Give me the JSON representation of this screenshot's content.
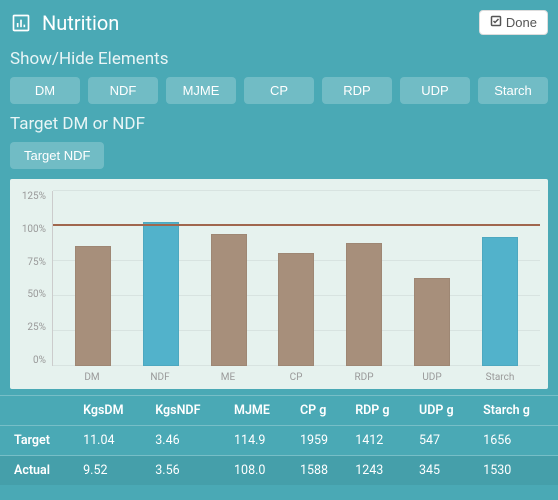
{
  "header": {
    "title": "Nutrition",
    "done_label": "Done"
  },
  "showhide": {
    "label": "Show/Hide Elements",
    "buttons": [
      "DM",
      "NDF",
      "MJME",
      "CP",
      "RDP",
      "UDP",
      "Starch"
    ]
  },
  "target_toggle": {
    "label": "Target DM or NDF",
    "button": "Target NDF"
  },
  "chart_data": {
    "type": "bar",
    "categories": [
      "DM",
      "NDF",
      "ME",
      "CP",
      "RDP",
      "UDP",
      "Starch"
    ],
    "values": [
      86,
      103,
      94,
      81,
      88,
      63,
      92
    ],
    "colors": [
      "brown",
      "blue",
      "brown",
      "brown",
      "brown",
      "brown",
      "blue"
    ],
    "ylabel": "",
    "xlabel": "",
    "ylim": [
      0,
      125
    ],
    "yticks": [
      "125%",
      "100%",
      "75%",
      "50%",
      "25%",
      "0%"
    ],
    "target_line": 100
  },
  "table": {
    "headers": [
      "",
      "KgsDM",
      "KgsNDF",
      "MJME",
      "CP g",
      "RDP g",
      "UDP g",
      "Starch g"
    ],
    "rows": [
      {
        "label": "Target",
        "cells": [
          "11.04",
          "3.46",
          "114.9",
          "1959",
          "1412",
          "547",
          "1656"
        ]
      },
      {
        "label": "Actual",
        "cells": [
          "9.52",
          "3.56",
          "108.0",
          "1588",
          "1243",
          "345",
          "1530"
        ]
      }
    ]
  }
}
